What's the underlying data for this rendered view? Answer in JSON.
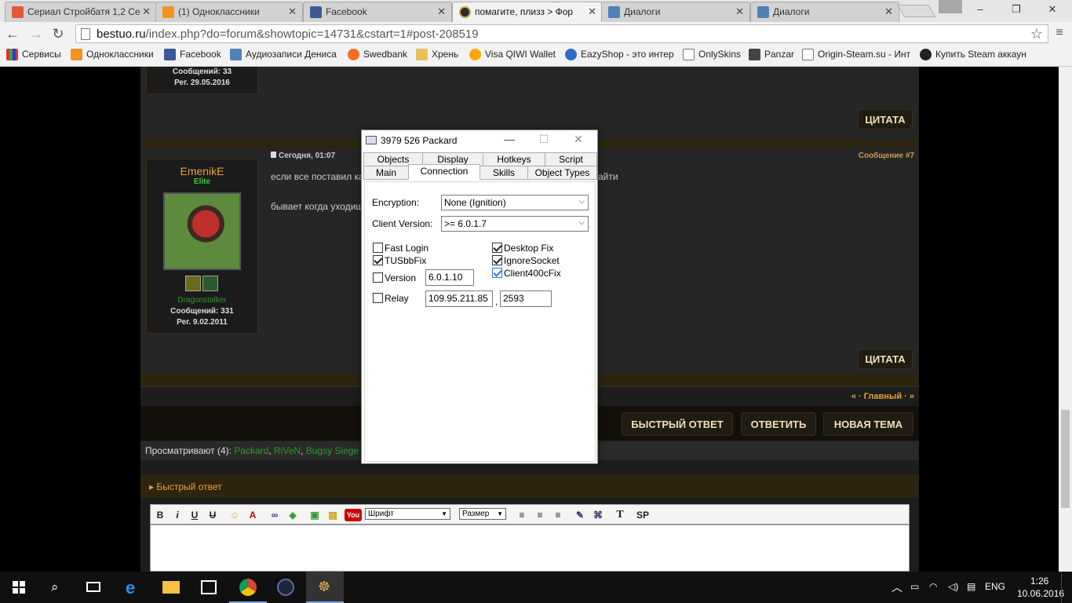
{
  "browser": {
    "tabs": [
      {
        "label": "Сериал Стройбатя 1,2 Се",
        "active": false
      },
      {
        "label": "(1) Одноклассники",
        "active": false
      },
      {
        "label": "Facebook",
        "active": false
      },
      {
        "label": "помагите, плизз  >  Фор",
        "active": true
      },
      {
        "label": "Диалоги",
        "active": false
      },
      {
        "label": "Диалоги",
        "active": false
      }
    ],
    "url_host": "bestuo.ru",
    "url_path": "/index.php?do=forum&showtopic=14731&cstart=1#post-208519",
    "bookmarks": [
      "Сервисы",
      "Одноклассники",
      "Facebook",
      "Аудиозаписи Дениса",
      "Swedbank",
      "Хрень",
      "Visa QIWI Wallet",
      "EazyShop - это интер",
      "OnlySkins",
      "Panzar",
      "Origin-Steam.su - Инт",
      "Купить Steam аккаун"
    ]
  },
  "forum": {
    "prev_user": {
      "posts": "Сообщений: 33",
      "reg": "Рег. 29.05.2016"
    },
    "quote_label": "ЦИТАТА",
    "post": {
      "username": "EmenikE",
      "rank": "Elite",
      "group": "Dragonstalker",
      "posts": "Сообщений: 331",
      "reg": "Рег. 9.02.2011",
      "date": "Сегодня, 01:07",
      "number": "Сообщение #7",
      "line1": "если все поставил ка",
      "line1_tail": "айти",
      "line2": "бывает когда уходиш"
    },
    "pagination": "« · Главный · »",
    "buttons": {
      "quick_reply": "БЫСТРЫЙ ОТВЕТ",
      "reply": "ОТВЕТИТЬ",
      "new_topic": "НОВАЯ ТЕМА"
    },
    "viewing_label": "Просматривают (4):",
    "viewers": [
      "Packard",
      "RiVeN",
      "Bugsy Siege"
    ],
    "quick_reply_title": "Быстрый ответ",
    "editor": {
      "font": "Шрифт",
      "size": "Размер",
      "sp": "SP",
      "t": "T"
    }
  },
  "dialog": {
    "title": "3979 526 Packard",
    "tabs_row1": [
      "Objects",
      "Display",
      "Hotkeys",
      "Script"
    ],
    "tabs_row2": [
      "Main",
      "Connection",
      "Skills",
      "Object Types"
    ],
    "active_tab": "Connection",
    "encryption_label": "Encryption:",
    "encryption_value": "None (Ignition)",
    "client_version_label": "Client Version:",
    "client_version_value": ">= 6.0.1.7",
    "fast_login": "Fast Login",
    "tusbbfix": "TUSbbFix",
    "version": "Version",
    "version_value": "6.0.1.10",
    "relay": "Relay",
    "relay_ip": "109.95.211.85",
    "relay_port": "2593",
    "relay_sep": ",",
    "desktop_fix": "Desktop Fix",
    "ignore_socket": "IgnoreSocket",
    "client400c": "Client400cFix"
  },
  "taskbar": {
    "lang": "ENG",
    "time": "1:26",
    "date": "10.06.2016"
  },
  "colors": {
    "accent": "#e8a23a",
    "green": "#33aa33",
    "viewer": "#2e9b2e"
  }
}
